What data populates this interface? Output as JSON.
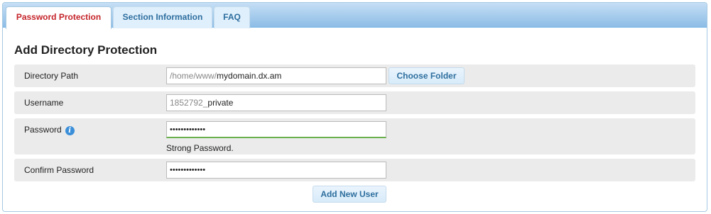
{
  "tabs": [
    {
      "label": "Password Protection",
      "active": true
    },
    {
      "label": "Section Information",
      "active": false
    },
    {
      "label": "FAQ",
      "active": false
    }
  ],
  "heading": "Add Directory Protection",
  "form": {
    "directory_path": {
      "label": "Directory Path",
      "prefix": "/home/www/",
      "value": "mydomain.dx.am",
      "button_label": "Choose Folder"
    },
    "username": {
      "label": "Username",
      "prefix": "1852792_",
      "value": "private"
    },
    "password": {
      "label": "Password",
      "info_icon": "info-icon",
      "masked_value": "•••••••••••••",
      "strength_text": "Strong Password."
    },
    "confirm_password": {
      "label": "Confirm Password",
      "masked_value": "•••••••••••••"
    },
    "submit_label": "Add New User"
  },
  "colors": {
    "tab_active_text": "#c5242a",
    "tab_text": "#2e6e9e",
    "row_bg": "#ebebeb",
    "strength_bar": "#6ab04c"
  }
}
